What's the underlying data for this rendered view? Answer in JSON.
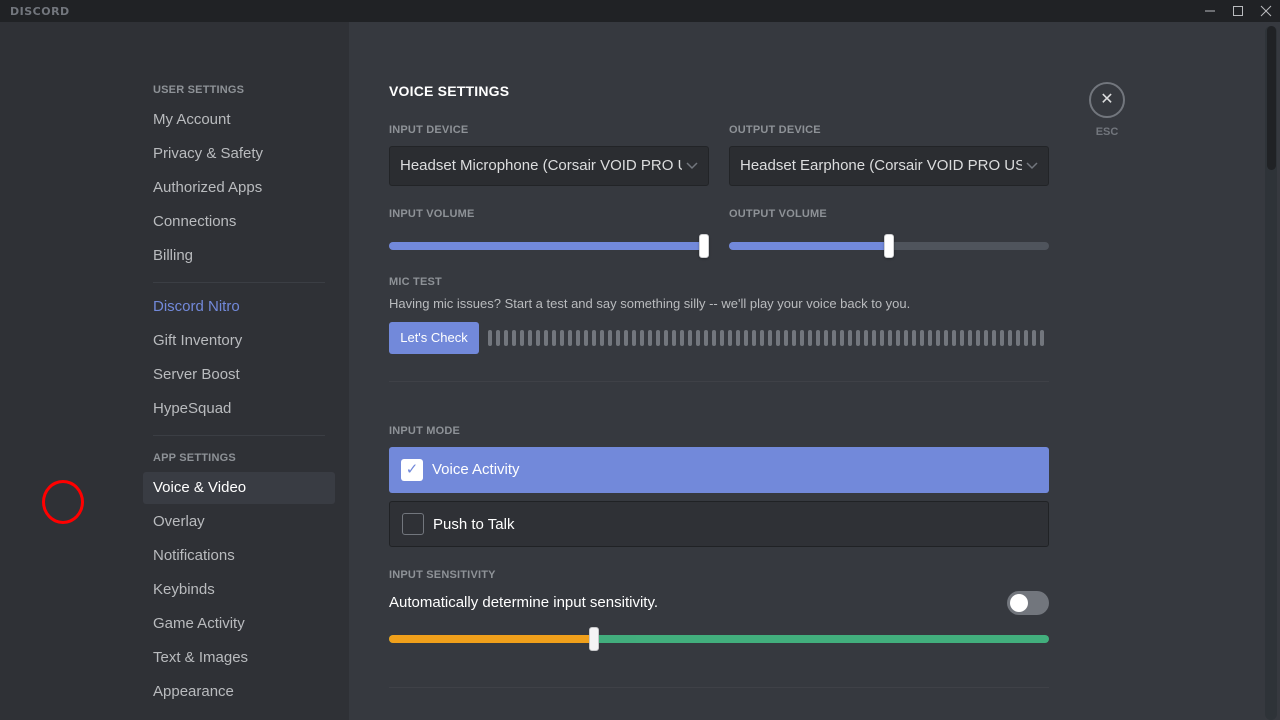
{
  "app": {
    "title": "DISCORD"
  },
  "window_controls": {
    "minimize": "—",
    "maximize": "☐",
    "close": "✕"
  },
  "sidebar": {
    "user_settings_header": "USER SETTINGS",
    "user_items": [
      {
        "label": "My Account"
      },
      {
        "label": "Privacy & Safety"
      },
      {
        "label": "Authorized Apps"
      },
      {
        "label": "Connections"
      },
      {
        "label": "Billing"
      }
    ],
    "nitro_items": [
      {
        "label": "Discord Nitro"
      },
      {
        "label": "Gift Inventory"
      },
      {
        "label": "Server Boost"
      },
      {
        "label": "HypeSquad"
      }
    ],
    "app_settings_header": "APP SETTINGS",
    "app_items": [
      {
        "label": "Voice & Video",
        "active": true
      },
      {
        "label": "Overlay"
      },
      {
        "label": "Notifications"
      },
      {
        "label": "Keybinds"
      },
      {
        "label": "Game Activity"
      },
      {
        "label": "Text & Images"
      },
      {
        "label": "Appearance"
      }
    ]
  },
  "main": {
    "title": "VOICE SETTINGS",
    "input_device": {
      "label": "INPUT DEVICE",
      "value": "Headset Microphone (Corsair VOID PRO USB Gaming Headset)"
    },
    "output_device": {
      "label": "OUTPUT DEVICE",
      "value": "Headset Earphone (Corsair VOID PRO USB Gaming Headset)"
    },
    "input_volume": {
      "label": "INPUT VOLUME",
      "percent": 100
    },
    "output_volume": {
      "label": "OUTPUT VOLUME",
      "percent": 50
    },
    "mic_test": {
      "label": "MIC TEST",
      "description": "Having mic issues? Start a test and say something silly -- we'll play your voice back to you.",
      "button": "Let's Check",
      "meter_level": 0
    },
    "input_mode": {
      "label": "INPUT MODE",
      "options": [
        {
          "label": "Voice Activity",
          "checked": true
        },
        {
          "label": "Push to Talk",
          "checked": false
        }
      ]
    },
    "input_sensitivity": {
      "label": "INPUT SENSITIVITY",
      "auto_label": "Automatically determine input sensitivity.",
      "auto_enabled": false,
      "threshold_percent": 31
    },
    "esc": {
      "icon": "✕",
      "label": "ESC"
    }
  },
  "colors": {
    "accent": "#7289da",
    "sensitivity_low": "#faa61a",
    "sensitivity_high": "#43b581",
    "highlight": "#ff0000"
  }
}
